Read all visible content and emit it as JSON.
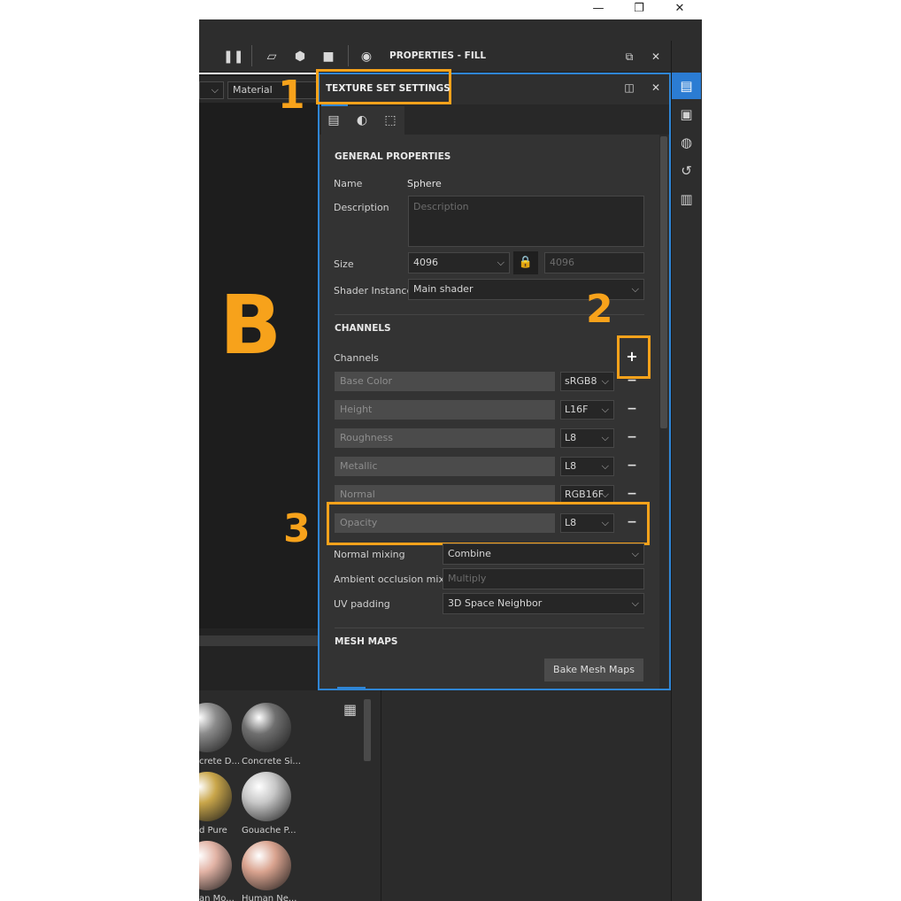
{
  "toolbar": {
    "properties_title": "PROPERTIES - FILL"
  },
  "viewport": {
    "material_select": "Material"
  },
  "annotations": {
    "b": "B",
    "one": "1",
    "two": "2",
    "three": "3"
  },
  "panel": {
    "title": "TEXTURE SET SETTINGS",
    "general": {
      "heading": "GENERAL PROPERTIES",
      "name_label": "Name",
      "name_value": "Sphere",
      "description_label": "Description",
      "description_placeholder": "Description",
      "size_label": "Size",
      "size_value": "4096",
      "size_linked_value": "4096",
      "shader_label": "Shader Instance",
      "shader_value": "Main shader"
    },
    "channels": {
      "heading": "CHANNELS",
      "label": "Channels",
      "add_label": "+",
      "remove_label": "−",
      "items": [
        {
          "name": "Base Color",
          "format": "sRGB8"
        },
        {
          "name": "Height",
          "format": "L16F"
        },
        {
          "name": "Roughness",
          "format": "L8"
        },
        {
          "name": "Metallic",
          "format": "L8"
        },
        {
          "name": "Normal",
          "format": "RGB16F"
        },
        {
          "name": "Opacity",
          "format": "L8"
        }
      ],
      "normal_mixing_label": "Normal mixing",
      "normal_mixing_value": "Combine",
      "ao_mixing_label": "Ambient occlusion mixing",
      "ao_mixing_value": "Multiply",
      "uv_padding_label": "UV padding",
      "uv_padding_value": "3D Space Neighbor"
    },
    "mesh_maps": {
      "heading": "MESH MAPS",
      "bake_label": "Bake Mesh Maps"
    }
  },
  "shelf": {
    "materials": [
      {
        "label": "crete D...",
        "color": "#8c8c8c"
      },
      {
        "label": "Concrete Si...",
        "color": "#6f6f6f"
      },
      {
        "label": "d Pure",
        "color": "#c9a64a"
      },
      {
        "label": "Gouache P...",
        "color": "#c7c7c7"
      },
      {
        "label": "an Mo...",
        "color": "#e2b3a5"
      },
      {
        "label": "Human Ne...",
        "color": "#d9a38f"
      }
    ]
  },
  "colors": {
    "accent": "#2f86d6",
    "annotation": "#f7a21b",
    "panel_bg": "#333333"
  }
}
